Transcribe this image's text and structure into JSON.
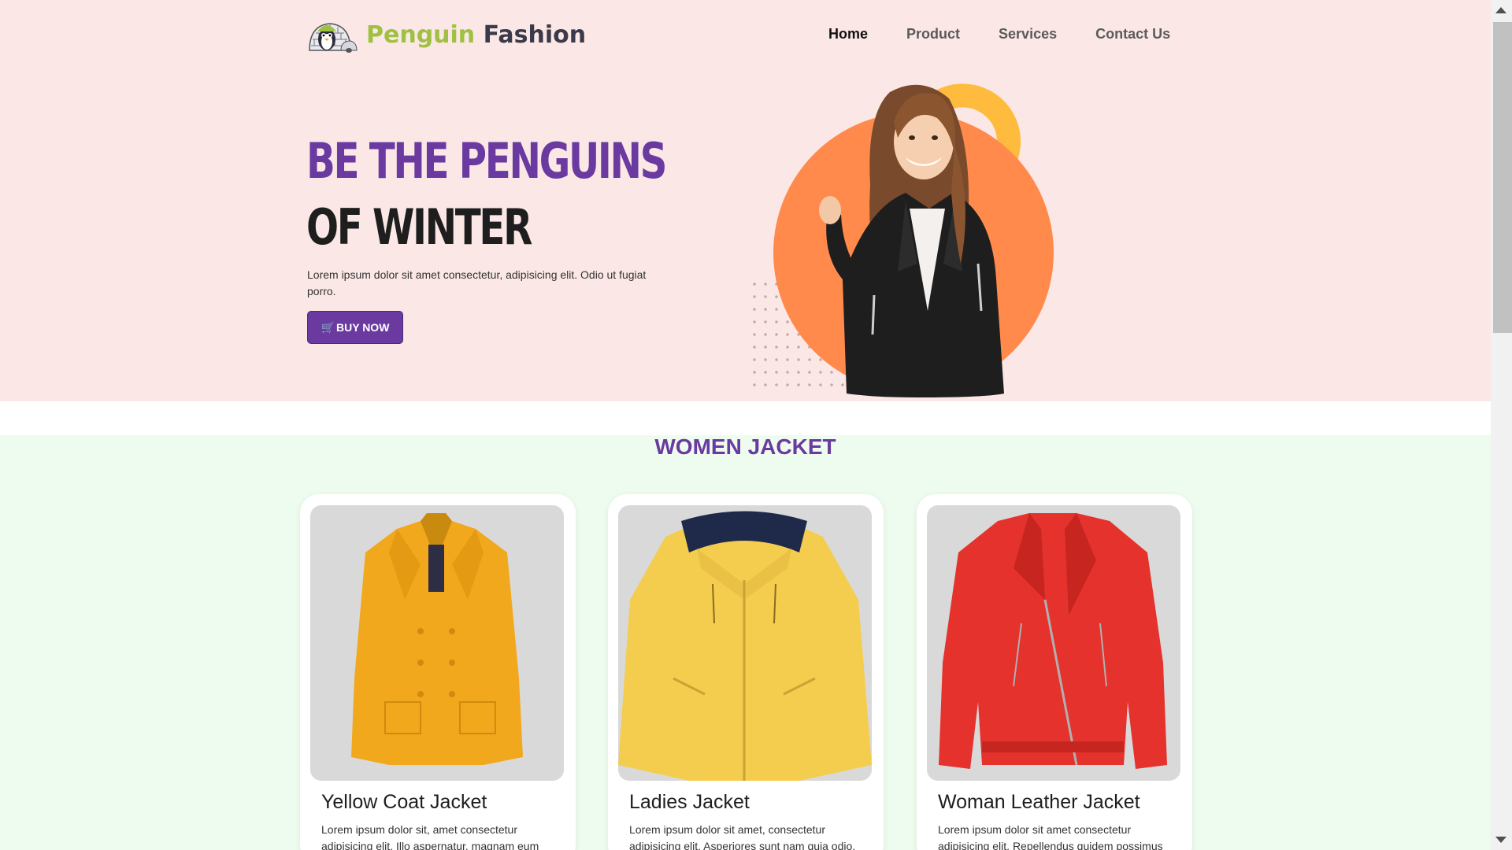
{
  "brand": {
    "name_part1": "Penguin",
    "name_part2": "Fashion",
    "color_green": "#9fc141",
    "color_dark": "#3a3a4a"
  },
  "nav": {
    "items": [
      "Home",
      "Product",
      "Services",
      "Contact Us"
    ],
    "active": "Home"
  },
  "hero": {
    "headline_line1": "BE THE PENGUINS",
    "headline_line2": "OF WINTER",
    "description": "Lorem ipsum dolor sit amet consectetur, adipisicing elit. Odio ut fugiat porro.",
    "button_label": "BUY NOW",
    "button_icon": "cart-icon",
    "accent_purple": "#6a3aa0",
    "accent_orange": "#ff8a4c",
    "accent_yellow": "#ffbb3d"
  },
  "products": {
    "section_title": "WOMEN JACKET",
    "items": [
      {
        "title": "Yellow Coat Jacket",
        "description": "Lorem ipsum dolor sit, amet consectetur adipisicing elit. Illo aspernatur, magnam eum",
        "color": "#f2a81c"
      },
      {
        "title": "Ladies Jacket",
        "description": "Lorem ipsum dolor sit amet, consectetur adipisicing elit. Asperiores sunt nam quia odio,",
        "color": "#f4cd4f"
      },
      {
        "title": "Woman Leather Jacket",
        "description": "Lorem ipsum dolor sit amet consectetur adipisicing elit. Repellendus quidem possimus",
        "color": "#e5322d"
      }
    ]
  }
}
